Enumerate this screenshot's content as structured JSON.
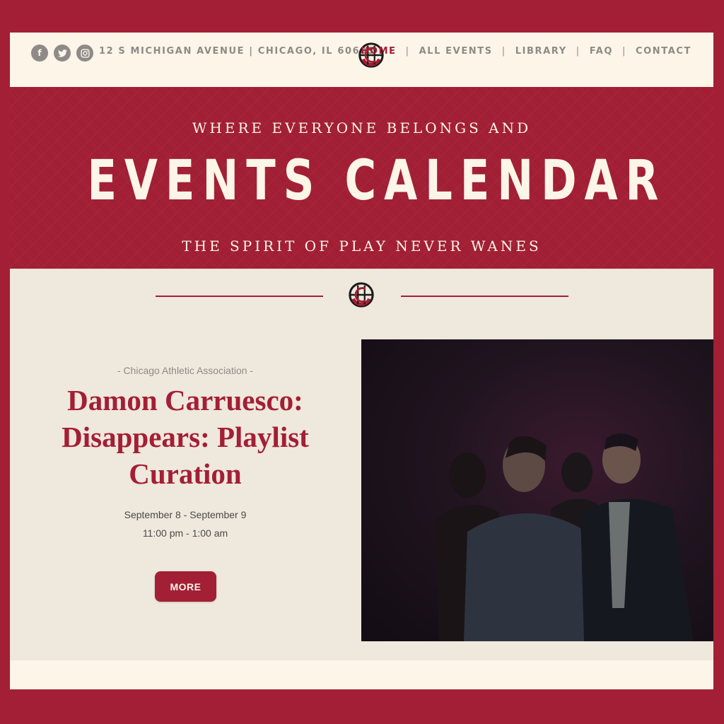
{
  "header": {
    "social": [
      {
        "name": "facebook-icon",
        "glyph": "f"
      },
      {
        "name": "twitter-icon",
        "glyph": "t"
      },
      {
        "name": "instagram-icon",
        "glyph": "◘"
      }
    ],
    "address": "12 S MICHIGAN AVENUE | CHICAGO, IL 60603",
    "nav": [
      {
        "label": "HOME",
        "active": true
      },
      {
        "label": "ALL EVENTS",
        "active": false
      },
      {
        "label": "LIBRARY",
        "active": false
      },
      {
        "label": "FAQ",
        "active": false
      },
      {
        "label": "CONTACT",
        "active": false
      }
    ]
  },
  "hero": {
    "line1": "WHERE EVERYONE BELONGS AND",
    "title": "EVENTS CALENDAR",
    "line2": "THE SPIRIT OF PLAY NEVER WANES"
  },
  "event": {
    "venue": "- Chicago Athletic Association -",
    "title": "Damon Carruesco: Disappears: Playlist Curation",
    "dates": "September 8 - September 9",
    "times": "11:00 pm - 1:00 am",
    "more_label": "MORE"
  },
  "colors": {
    "brand_red": "#a31f35",
    "cream": "#fcf5e8",
    "background": "#efe8dc",
    "muted_gray": "#8e8a88"
  }
}
